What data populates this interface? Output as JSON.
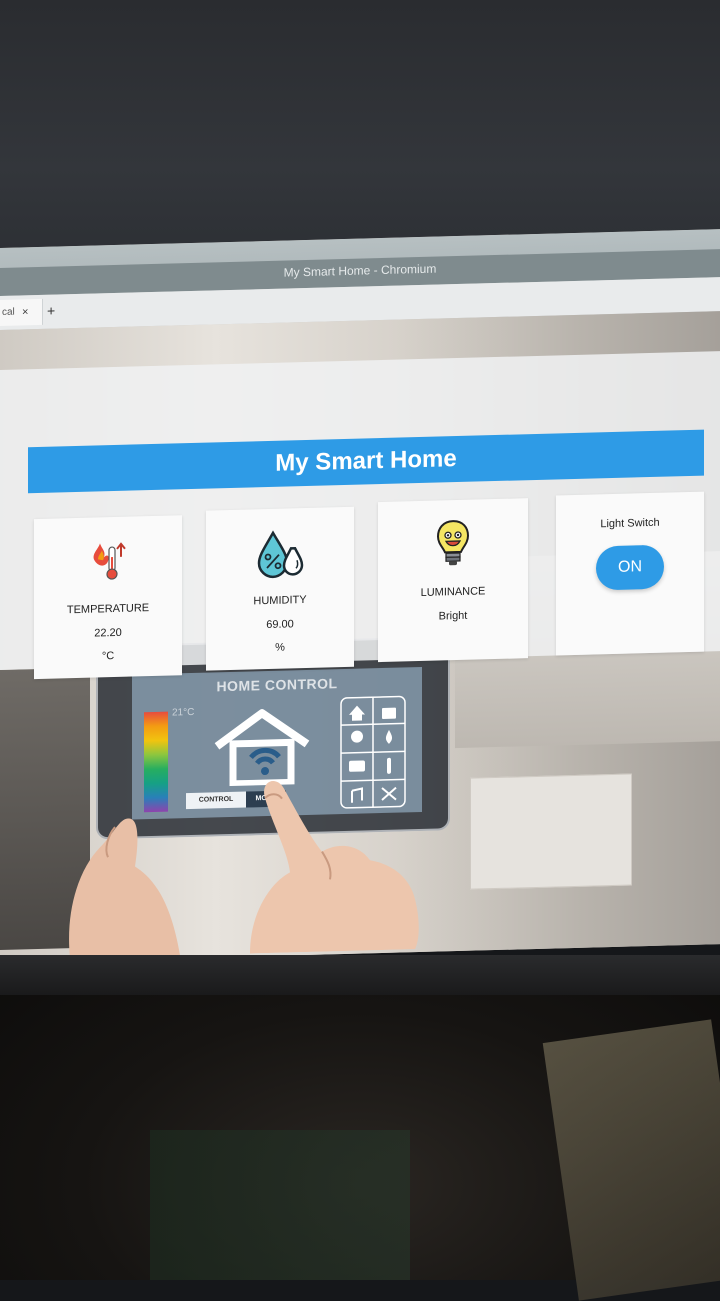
{
  "browser": {
    "window_title": "My Smart Home - Chromium",
    "tab_label": "cal",
    "tab_close": "×",
    "new_tab": "+"
  },
  "app": {
    "title": "My Smart Home",
    "cards": [
      {
        "label": "TEMPERATURE",
        "value": "22.20",
        "unit": "°C"
      },
      {
        "label": "HUMIDITY",
        "value": "69.00",
        "unit": "%"
      },
      {
        "label": "LUMINANCE",
        "value": "Bright"
      }
    ],
    "switch": {
      "label": "Light Switch",
      "button": "ON"
    }
  },
  "background_image": {
    "heading": "HOME CONTROL",
    "temp_readout": "21°C",
    "tabs": [
      "CONTROL",
      "MODE"
    ]
  },
  "colors": {
    "accent": "#2e9be6",
    "card_bg": "#fafafa"
  },
  "icons": [
    "thermometer-icon",
    "humidity-drops-icon",
    "lightbulb-icon"
  ]
}
